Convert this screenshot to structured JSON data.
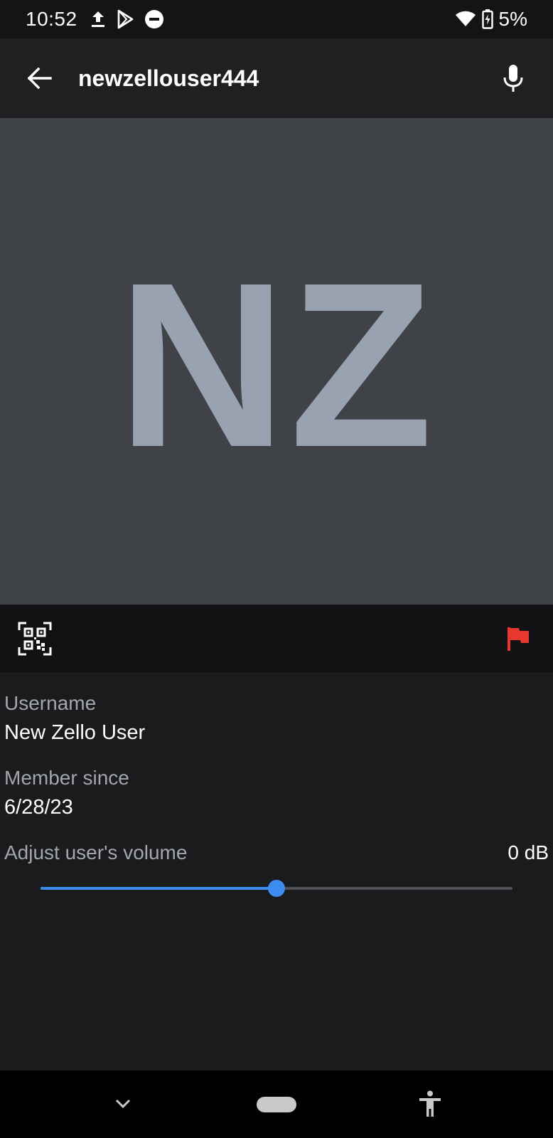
{
  "status_bar": {
    "time": "10:52",
    "battery": "5%",
    "icons": [
      "upload-icon",
      "play-store-icon",
      "do-not-disturb-icon",
      "wifi-icon",
      "battery-charging-icon"
    ]
  },
  "app_bar": {
    "title": "newzellouser444",
    "back_icon": "arrow-back-icon",
    "mic_icon": "microphone-icon"
  },
  "avatar": {
    "initials": "NZ",
    "background_color": "#3f4247",
    "initials_color": "#98a2b0"
  },
  "actions": {
    "qr_icon": "qr-code-icon",
    "report_icon": "flag-icon",
    "report_color": "#e8372c"
  },
  "details": {
    "username_label": "Username",
    "username_value": "New Zello User",
    "member_since_label": "Member since",
    "member_since_value": "6/28/23",
    "volume_label": "Adjust user's volume",
    "volume_value": "0 dB",
    "volume_fraction": 0.5,
    "accent_color": "#3d8cf0"
  },
  "nav_bar": {
    "icons": [
      "chevron-down-icon",
      "home-pill",
      "accessibility-icon"
    ]
  }
}
